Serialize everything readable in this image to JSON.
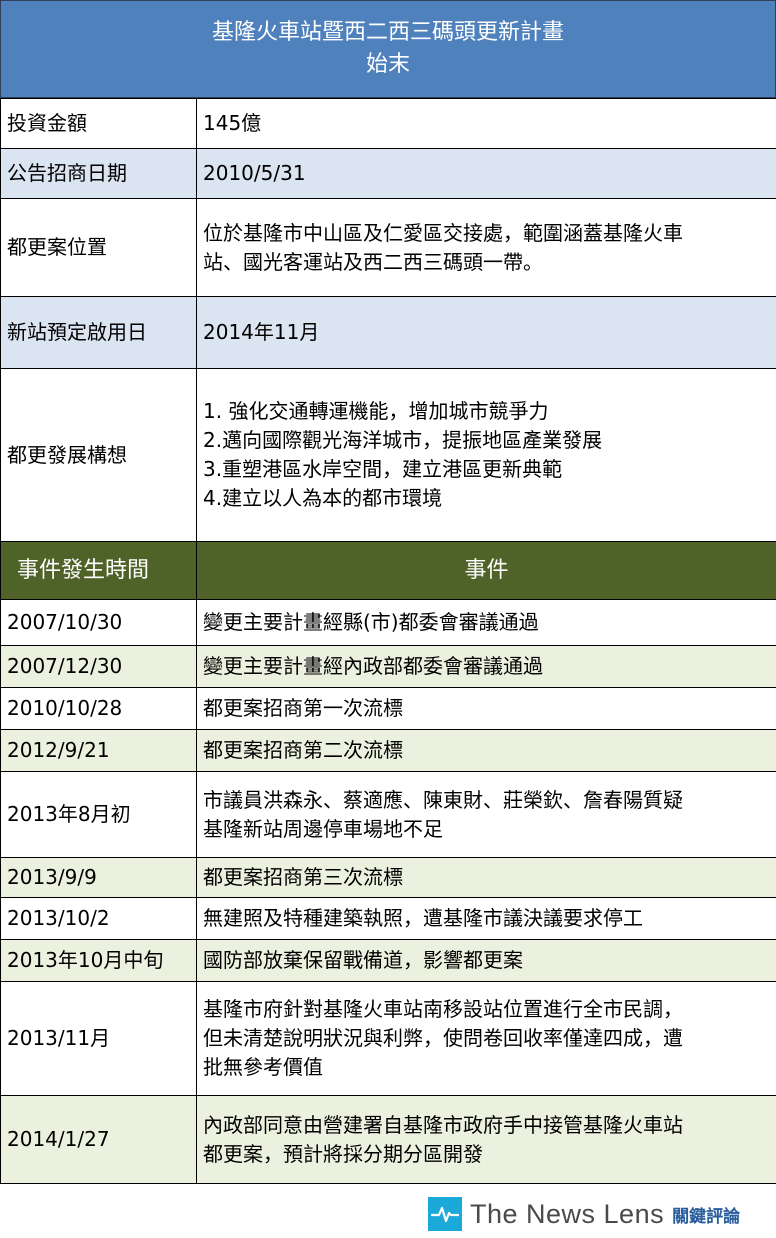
{
  "title": {
    "line1": "基隆火車站暨西二西三碼頭更新計畫",
    "line2": "始末"
  },
  "info_rows": [
    {
      "label": "投資金額",
      "value_lines": [
        "145億"
      ]
    },
    {
      "label": "公告招商日期",
      "value_lines": [
        "2010/5/31"
      ]
    },
    {
      "label": "都更案位置",
      "value_lines": [
        "位於基隆市中山區及仁愛區交接處，範圍涵蓋基隆火車",
        "站、國光客運站及西二西三碼頭一帶。"
      ]
    },
    {
      "label": "新站預定啟用日",
      "value_lines": [
        "2014年11月"
      ]
    },
    {
      "label": "都更發展構想",
      "value_lines": [
        "1. 強化交通轉運機能，增加城市競爭力",
        "2.邁向國際觀光海洋城市，提振地區產業發展",
        "3.重塑港區水岸空間，建立港區更新典範",
        "4.建立以人為本的都市環境"
      ]
    }
  ],
  "events_header": {
    "date": "事件發生時間",
    "event": "事件"
  },
  "events": [
    {
      "date": "2007/10/30",
      "event_lines": [
        "變更主要計畫經縣(市)都委會審議通過"
      ]
    },
    {
      "date": "2007/12/30",
      "event_lines": [
        "變更主要計畫經內政部都委會審議通過"
      ]
    },
    {
      "date": "2010/10/28",
      "event_lines": [
        "都更案招商第一次流標"
      ]
    },
    {
      "date": "2012/9/21",
      "event_lines": [
        "都更案招商第二次流標"
      ]
    },
    {
      "date": "2013年8月初",
      "event_lines": [
        "市議員洪森永、蔡適應、陳東財、莊榮欽、詹春陽質疑",
        "基隆新站周邊停車場地不足"
      ]
    },
    {
      "date": "2013/9/9",
      "event_lines": [
        "都更案招商第三次流標"
      ]
    },
    {
      "date": "2013/10/2",
      "event_lines": [
        "無建照及特種建築執照，遭基隆市議決議要求停工"
      ]
    },
    {
      "date": "2013年10月中旬",
      "event_lines": [
        "國防部放棄保留戰備道，影響都更案"
      ]
    },
    {
      "date": "2013/11月",
      "event_lines": [
        "基隆市府針對基隆火車站南移設站位置進行全市民調，",
        "但未清楚說明狀況與利弊，使問卷回收率僅達四成，遭",
        "批無參考價值"
      ]
    },
    {
      "date": "2014/1/27",
      "event_lines": [
        "內政部同意由營建署自基隆市政府手中接管基隆火車站",
        "都更案，預計將採分期分區開發"
      ]
    }
  ],
  "footer": {
    "logo_icon": "pulse-line-icon",
    "brand": "The News Lens",
    "brand_zh": "關鍵評論",
    "accent_color": "#1ba9d8"
  },
  "colors": {
    "title_bg": "#4f81bd",
    "info_shade": "#dbe5f1",
    "events_header_bg": "#4f6228",
    "events_shade": "#ebf1de"
  }
}
